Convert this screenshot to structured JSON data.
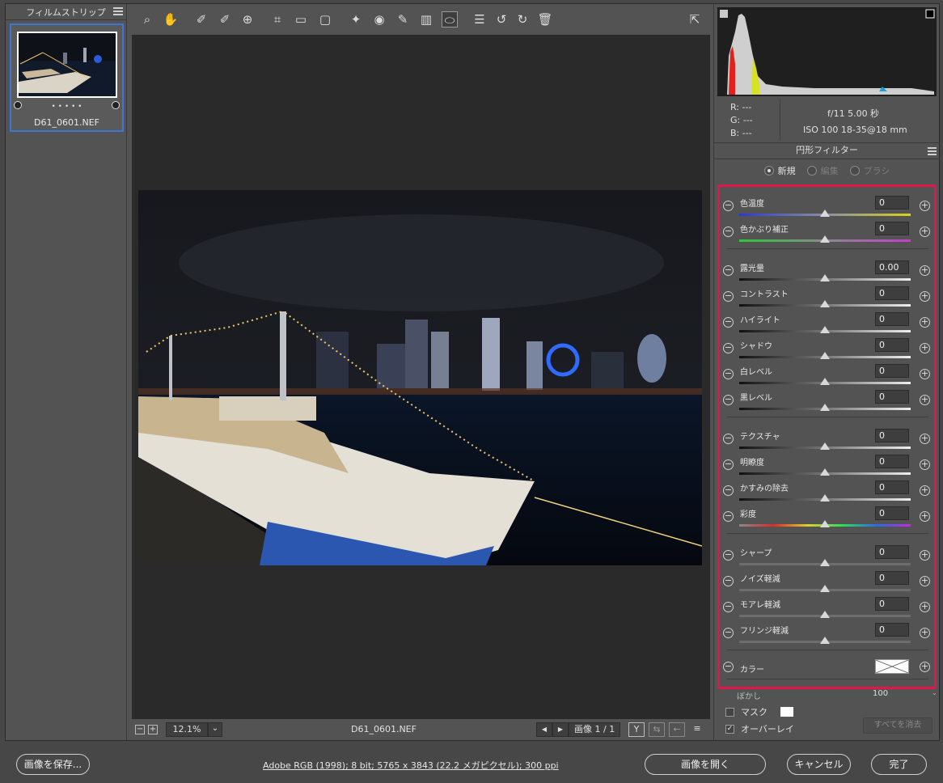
{
  "filmstrip": {
    "title": "フィルムストリップ",
    "thumbnail": {
      "filename": "D61_0601.NEF",
      "rating_dots": "• • • • •"
    }
  },
  "toolbar": {
    "tools": [
      "zoom-icon",
      "hand-icon",
      "white-balance-icon",
      "color-sampler-icon",
      "target-adjust-icon",
      "crop-icon",
      "straighten-icon",
      "transform-icon",
      "spot-removal-icon",
      "redeye-icon",
      "brush-icon",
      "graduated-filter-icon",
      "radial-filter-icon",
      "presets-icon",
      "rotate-left-icon",
      "rotate-right-icon",
      "trash-icon"
    ],
    "export": "export-icon"
  },
  "status": {
    "zoom": "12.1%",
    "filename": "D61_0601.NEF",
    "image_count": "画像 1 / 1",
    "view_label": "Y"
  },
  "info": {
    "r": "R:   ---",
    "g": "G:   ---",
    "b": "B:   ---",
    "aperture_shutter": "f/11    5.00 秒",
    "iso_lens": "ISO 100    18-35@18 mm"
  },
  "panel": {
    "title": "円形フィルター",
    "modes": [
      {
        "label": "新規",
        "selected": true,
        "enabled": true
      },
      {
        "label": "編集",
        "selected": false,
        "enabled": false
      },
      {
        "label": "ブラシ",
        "selected": false,
        "enabled": false
      }
    ],
    "sliders": [
      {
        "label": "色温度",
        "value": "0",
        "track": "temp"
      },
      {
        "label": "色かぶり補正",
        "value": "0",
        "track": "tint"
      },
      {
        "label": "露光量",
        "value": "0.00",
        "track": "gray"
      },
      {
        "label": "コントラスト",
        "value": "0",
        "track": "gray"
      },
      {
        "label": "ハイライト",
        "value": "0",
        "track": "gray"
      },
      {
        "label": "シャドウ",
        "value": "0",
        "track": "gray"
      },
      {
        "label": "白レベル",
        "value": "0",
        "track": "gray"
      },
      {
        "label": "黒レベル",
        "value": "0",
        "track": "gray"
      },
      {
        "label": "テクスチャ",
        "value": "0",
        "track": "gray"
      },
      {
        "label": "明瞭度",
        "value": "0",
        "track": "gray"
      },
      {
        "label": "かすみの除去",
        "value": "0",
        "track": "gray"
      },
      {
        "label": "彩度",
        "value": "0",
        "track": "sat"
      },
      {
        "label": "シャープ",
        "value": "0",
        "track": "flat"
      },
      {
        "label": "ノイズ軽減",
        "value": "0",
        "track": "flat"
      },
      {
        "label": "モアレ軽減",
        "value": "0",
        "track": "flat"
      },
      {
        "label": "フリンジ軽減",
        "value": "0",
        "track": "flat"
      }
    ],
    "color_label": "カラー",
    "feather_label": "ぼかし",
    "feather_value": "100",
    "mask_label": "マスク",
    "mask_checked": false,
    "overlay_label": "オーバーレイ",
    "overlay_checked": true,
    "clear_all": "すべてを消去"
  },
  "footer": {
    "save": "画像を保存...",
    "workflow": "Adobe RGB (1998); 8 bit; 5765 x 3843 (22.2 メガピクセル); 300 ppi",
    "open": "画像を開く",
    "cancel": "キャンセル",
    "done": "完了"
  },
  "colors": {
    "highlight_border": "#e3154d",
    "selection": "#3c77d6"
  }
}
